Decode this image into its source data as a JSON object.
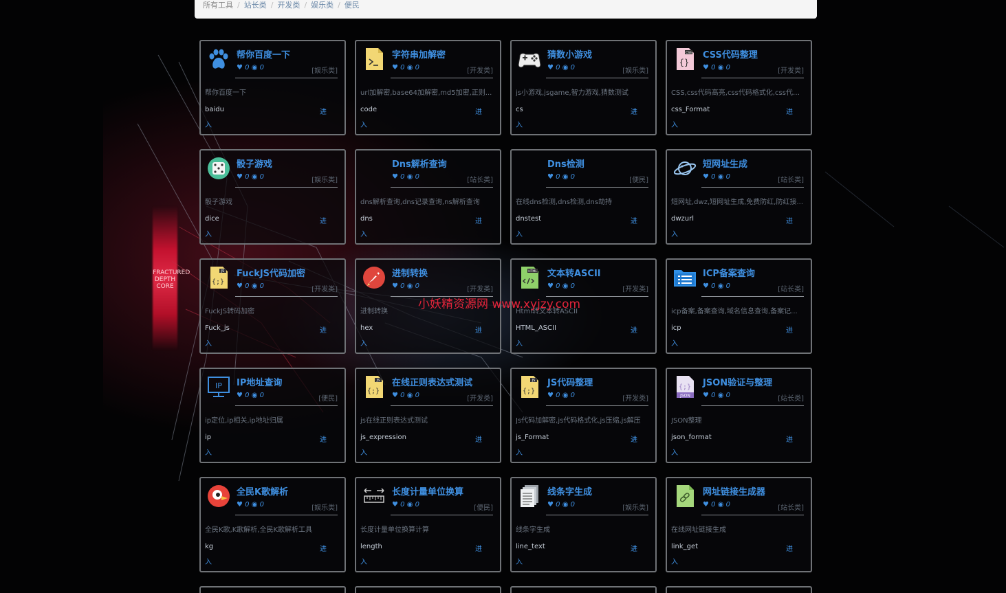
{
  "breadcrumb": [
    "所有工具",
    "站长类",
    "开发类",
    "娱乐类",
    "便民"
  ],
  "watermark": "小妖精资源网 www.xyjzy.com",
  "background_text": "FRACTURED DEPTH CORE",
  "enter_label_top": "进",
  "enter_label_bottom": "入",
  "tools": [
    {
      "title": "帮你百度一下",
      "likes": "0",
      "views": "0",
      "category": "[娱乐类]",
      "desc": "帮你百度一下",
      "code": "baidu",
      "icon": "paw-icon"
    },
    {
      "title": "字符串加解密",
      "likes": "0",
      "views": "0",
      "category": "[开发类]",
      "desc": "url加解密,base64加解密,md5加密,正则...",
      "code": "code",
      "icon": "terminal-file-icon"
    },
    {
      "title": "猜数小游戏",
      "likes": "0",
      "views": "0",
      "category": "[娱乐类]",
      "desc": "js小游戏,jsgame,智力游戏,猜数测试",
      "code": "cs",
      "icon": "gamepad-icon"
    },
    {
      "title": "CSS代码整理",
      "likes": "0",
      "views": "0",
      "category": "[开发类]",
      "desc": "CSS,css代码高亮,css代码格式化,css代码...",
      "code": "css_Format",
      "icon": "css-file-icon"
    },
    {
      "title": "骰子游戏",
      "likes": "0",
      "views": "0",
      "category": "[娱乐类]",
      "desc": "骰子游戏",
      "code": "dice",
      "icon": "dice-icon"
    },
    {
      "title": "Dns解析查询",
      "likes": "0",
      "views": "0",
      "category": "[站长类]",
      "desc": "dns解析查询,dns记录查询,ns解析查询",
      "code": "dns",
      "icon": "blank-icon"
    },
    {
      "title": "Dns检测",
      "likes": "0",
      "views": "0",
      "category": "[便民]",
      "desc": "在线dns检测,dns检测,dns劫持",
      "code": "dnstest",
      "icon": "blank-icon"
    },
    {
      "title": "短网址生成",
      "likes": "0",
      "views": "0",
      "category": "[站长类]",
      "desc": "短网址,dwz,短网址生成,免费防红,防红接...",
      "code": "dwzurl",
      "icon": "planet-icon"
    },
    {
      "title": "FuckJS代码加密",
      "likes": "0",
      "views": "0",
      "category": "[开发类]",
      "desc": "FuckJS转码加密",
      "code": "Fuck_js",
      "icon": "js-file-icon"
    },
    {
      "title": "进制转换",
      "likes": "0",
      "views": "0",
      "category": "[开发类]",
      "desc": "进制转换",
      "code": "hex",
      "icon": "rocket-icon"
    },
    {
      "title": "文本转ASCII",
      "likes": "0",
      "views": "0",
      "category": "[开发类]",
      "desc": "Html转文本转ASCII",
      "code": "HTML_ASCII",
      "icon": "html-file-icon"
    },
    {
      "title": "ICP备案查询",
      "likes": "0",
      "views": "0",
      "category": "[站长类]",
      "desc": "icp备案,备案查询,域名信息查询,备案记...",
      "code": "icp",
      "icon": "folder-list-icon"
    },
    {
      "title": "IP地址查询",
      "likes": "0",
      "views": "0",
      "category": "[便民]",
      "desc": "ip定位,ip相关,ip地址归属",
      "code": "ip",
      "icon": "monitor-ip-icon"
    },
    {
      "title": "在线正则表达式测试",
      "likes": "0",
      "views": "0",
      "category": "[开发类]",
      "desc": "js在线正则表达式测试",
      "code": "js_expression",
      "icon": "js-file-icon"
    },
    {
      "title": "JS代码整理",
      "likes": "0",
      "views": "0",
      "category": "[开发类]",
      "desc": "Js代码加解密,js代码格式化,js压缩,js解压",
      "code": "js_Format",
      "icon": "js-file-icon"
    },
    {
      "title": "JSON验证与整理",
      "likes": "0",
      "views": "0",
      "category": "[站长类]",
      "desc": "JSON整理",
      "code": "json_format",
      "icon": "json-file-icon"
    },
    {
      "title": "全民K歌解析",
      "likes": "0",
      "views": "0",
      "category": "[娱乐类]",
      "desc": "全民K歌,K歌解析,全民K歌解析工具",
      "code": "kg",
      "icon": "bird-icon"
    },
    {
      "title": "长度计量单位换算",
      "likes": "0",
      "views": "0",
      "category": "[便民]",
      "desc": "长度计量单位换算计算",
      "code": "length",
      "icon": "ruler-icon"
    },
    {
      "title": "线条字生成",
      "likes": "0",
      "views": "0",
      "category": "[娱乐类]",
      "desc": "线条字生成",
      "code": "line_text",
      "icon": "document-stack-icon"
    },
    {
      "title": "网址链接生成器",
      "likes": "0",
      "views": "0",
      "category": "[站长类]",
      "desc": "在线网址链接生成",
      "code": "link_get",
      "icon": "link-file-icon"
    }
  ]
}
